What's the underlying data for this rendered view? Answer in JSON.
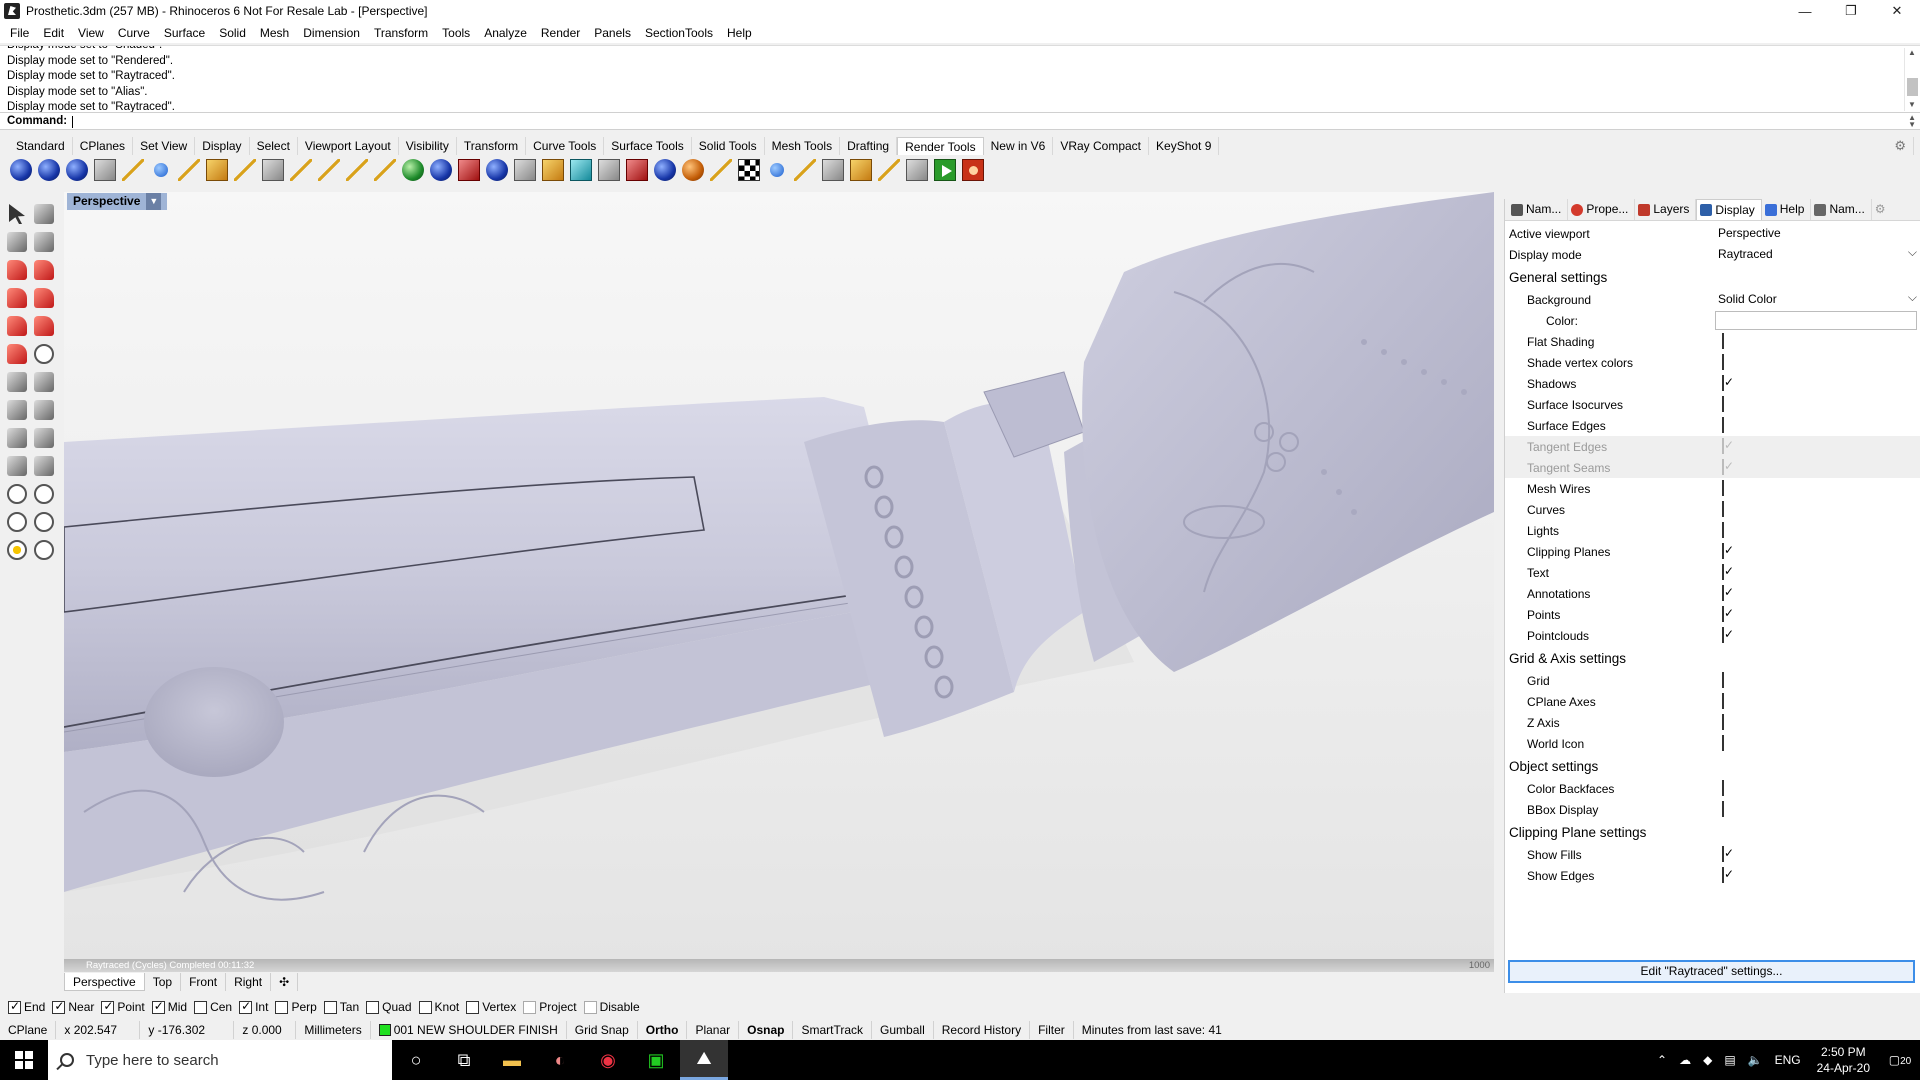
{
  "window": {
    "title": "Prosthetic.3dm (257 MB) - Rhinoceros 6 Not For Resale Lab - [Perspective]",
    "controls": [
      "—",
      "❐",
      "✕"
    ]
  },
  "menu": [
    "File",
    "Edit",
    "View",
    "Curve",
    "Surface",
    "Solid",
    "Mesh",
    "Dimension",
    "Transform",
    "Tools",
    "Analyze",
    "Render",
    "Panels",
    "SectionTools",
    "Help"
  ],
  "command": {
    "history": [
      "Display mode set to \"Shaded\".",
      "Display mode set to \"Rendered\".",
      "Display mode set to \"Raytraced\".",
      "Display mode set to \"Alias\".",
      "Display mode set to \"Raytraced\"."
    ],
    "prompt": "Command:"
  },
  "toolbar_tabs": [
    "Standard",
    "CPlanes",
    "Set View",
    "Display",
    "Select",
    "Viewport Layout",
    "Visibility",
    "Transform",
    "Curve Tools",
    "Surface Tools",
    "Solid Tools",
    "Mesh Tools",
    "Drafting",
    "Render Tools",
    "New in V6",
    "VRay Compact",
    "KeyShot 9"
  ],
  "active_toolbar_tab": "Render Tools",
  "viewport": {
    "name": "Perspective",
    "render_status": "Raytraced (Cycles)    Completed    00:11:32",
    "render_passes": "1000",
    "tabs": [
      "Perspective",
      "Top",
      "Front",
      "Right"
    ],
    "add_tab": "✣"
  },
  "panel": {
    "tabs": [
      {
        "label": "Nam...",
        "icon": "named-views-icon",
        "color": "#555555"
      },
      {
        "label": "Prope...",
        "icon": "properties-icon",
        "color": "#d33a2c"
      },
      {
        "label": "Layers",
        "icon": "layers-icon",
        "color": "#c0392b"
      },
      {
        "label": "Display",
        "icon": "display-icon",
        "color": "#2d5fa8"
      },
      {
        "label": "Help",
        "icon": "help-icon",
        "color": "#3a6fd8"
      },
      {
        "label": "Nam...",
        "icon": "named-cplanes-icon",
        "color": "#666666"
      }
    ],
    "active_tab": "Display",
    "active_viewport": {
      "label": "Active viewport",
      "value": "Perspective"
    },
    "display_mode": {
      "label": "Display mode",
      "value": "Raytraced"
    },
    "general_title": "General settings",
    "background": {
      "label": "Background",
      "value": "Solid Color"
    },
    "color_label": "Color:",
    "color_value": "#ffffff",
    "general": [
      {
        "label": "Flat Shading",
        "checked": false,
        "disabled": false
      },
      {
        "label": "Shade vertex colors",
        "checked": false,
        "disabled": false
      },
      {
        "label": "Shadows",
        "checked": true,
        "disabled": false
      },
      {
        "label": "Surface Isocurves",
        "checked": false,
        "disabled": false
      },
      {
        "label": "Surface Edges",
        "checked": false,
        "disabled": false
      },
      {
        "label": "Tangent Edges",
        "checked": true,
        "disabled": true
      },
      {
        "label": "Tangent Seams",
        "checked": true,
        "disabled": true
      },
      {
        "label": "Mesh Wires",
        "checked": false,
        "disabled": false
      },
      {
        "label": "Curves",
        "checked": false,
        "disabled": false
      },
      {
        "label": "Lights",
        "checked": false,
        "disabled": false
      },
      {
        "label": "Clipping Planes",
        "checked": true,
        "disabled": false
      },
      {
        "label": "Text",
        "checked": true,
        "disabled": false
      },
      {
        "label": "Annotations",
        "checked": true,
        "disabled": false
      },
      {
        "label": "Points",
        "checked": true,
        "disabled": false
      },
      {
        "label": "Pointclouds",
        "checked": true,
        "disabled": false
      }
    ],
    "grid_title": "Grid & Axis settings",
    "grid": [
      {
        "label": "Grid",
        "checked": false
      },
      {
        "label": "CPlane Axes",
        "checked": false
      },
      {
        "label": "Z Axis",
        "checked": false
      },
      {
        "label": "World Icon",
        "checked": false
      }
    ],
    "object_title": "Object settings",
    "object": [
      {
        "label": "Color Backfaces",
        "checked": false
      },
      {
        "label": "BBox Display",
        "checked": false
      }
    ],
    "clipping_title": "Clipping Plane settings",
    "clipping": [
      {
        "label": "Show Fills",
        "checked": true
      },
      {
        "label": "Show Edges",
        "checked": true
      }
    ],
    "edit_button": "Edit \"Raytraced\" settings..."
  },
  "osnap": [
    {
      "label": "End",
      "checked": true,
      "dim": false
    },
    {
      "label": "Near",
      "checked": true,
      "dim": false
    },
    {
      "label": "Point",
      "checked": true,
      "dim": false
    },
    {
      "label": "Mid",
      "checked": true,
      "dim": false
    },
    {
      "label": "Cen",
      "checked": false,
      "dim": false
    },
    {
      "label": "Int",
      "checked": true,
      "dim": false
    },
    {
      "label": "Perp",
      "checked": false,
      "dim": false
    },
    {
      "label": "Tan",
      "checked": false,
      "dim": false
    },
    {
      "label": "Quad",
      "checked": false,
      "dim": false
    },
    {
      "label": "Knot",
      "checked": false,
      "dim": false
    },
    {
      "label": "Vertex",
      "checked": false,
      "dim": false
    },
    {
      "label": "Project",
      "checked": false,
      "dim": true
    },
    {
      "label": "Disable",
      "checked": false,
      "dim": true
    }
  ],
  "status": {
    "cplane": "CPlane",
    "x": "x 202.547",
    "y": "y -176.302",
    "z": "z 0.000",
    "units": "Millimeters",
    "layer": "001 NEW SHOULDER FINISH",
    "layer_color": "#20e020",
    "grid_snap": "Grid Snap",
    "ortho": "Ortho",
    "planar": "Planar",
    "osnap": "Osnap",
    "smarttrack": "SmartTrack",
    "gumball": "Gumball",
    "record_history": "Record History",
    "filter": "Filter",
    "save_info": "Minutes from last save: 41"
  },
  "taskbar": {
    "search_placeholder": "Type here to search",
    "language": "ENG",
    "time": "2:50 PM",
    "date": "24-Apr-20",
    "notifications": "20"
  }
}
